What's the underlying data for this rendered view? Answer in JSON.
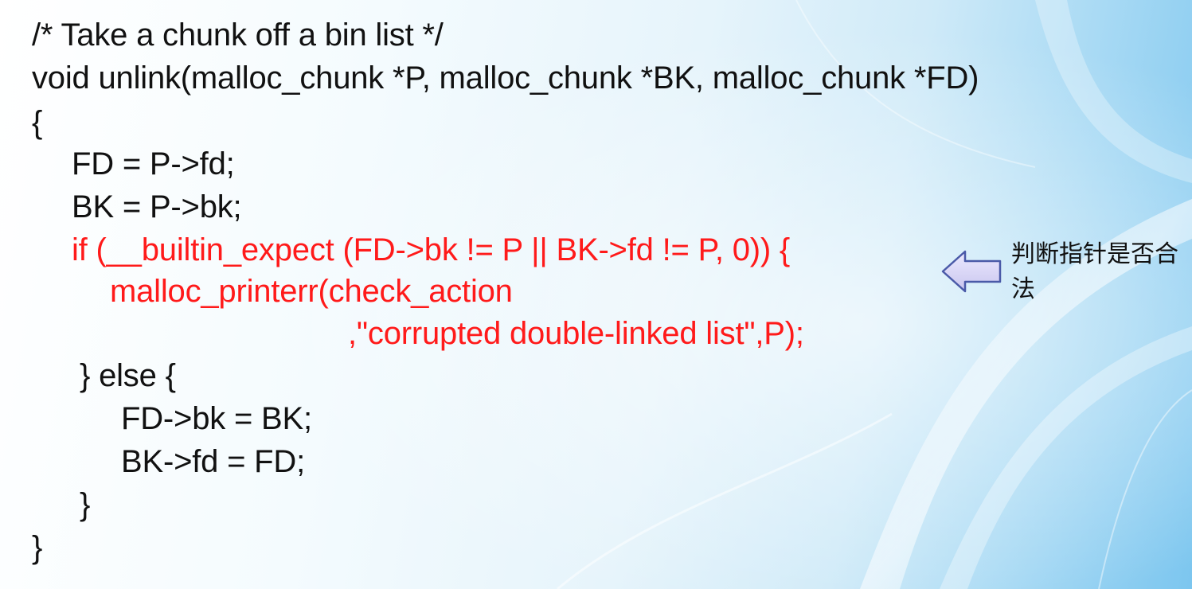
{
  "code": {
    "lines": [
      "/* Take a chunk off a bin list */",
      "void unlink(malloc_chunk *P, malloc_chunk *BK, malloc_chunk *FD)",
      "{",
      "FD = P->fd;",
      "BK = P->bk;",
      "if (__builtin_expect (FD->bk != P || BK->fd != P, 0)) {",
      "malloc_printerr(check_action",
      ",\"corrupted double-linked list\",P);",
      "} else {",
      "FD->bk = BK;",
      "BK->fd = FD;",
      "}",
      "}"
    ]
  },
  "annotation": {
    "text": "判断指针是否合法",
    "arrow_icon": "left-arrow-icon"
  },
  "colors": {
    "code_text": "#111111",
    "highlight": "#ff1a1a",
    "arrow_fill": "#d8d6f2",
    "arrow_stroke": "#4a5aa8"
  }
}
